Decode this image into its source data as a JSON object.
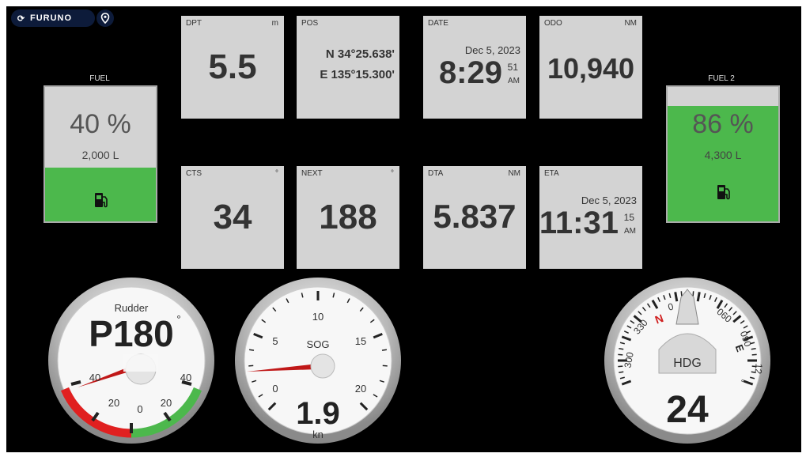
{
  "header": {
    "brand": "FURUNO",
    "brand_icon": "refresh-icon",
    "location_icon": "location-pin-icon"
  },
  "tiles": {
    "dpt": {
      "label": "DPT",
      "unit": "m",
      "value": "5.5"
    },
    "pos": {
      "label": "POS",
      "lat": "N 34°25.638'",
      "lon": "E 135°15.300'"
    },
    "date": {
      "label": "DATE",
      "date": "Dec 5, 2023",
      "time": "8:29",
      "seconds": "51",
      "ampm": "AM"
    },
    "odo": {
      "label": "ODO",
      "unit": "NM",
      "value": "10,940"
    },
    "cts": {
      "label": "CTS",
      "unit": "°",
      "value": "34"
    },
    "next": {
      "label": "NEXT",
      "unit": "°",
      "value": "188"
    },
    "dta": {
      "label": "DTA",
      "unit": "NM",
      "value": "5.837"
    },
    "eta": {
      "label": "ETA",
      "date": "Dec 5, 2023",
      "time": "11:31",
      "seconds": "15",
      "ampm": "AM"
    }
  },
  "fuel1": {
    "title": "FUEL",
    "percent": "40 %",
    "volume": "2,000 L",
    "level": 0.4,
    "icon": "fuel-pump-icon"
  },
  "fuel2": {
    "title": "FUEL 2",
    "percent": "86 %",
    "volume": "4,300 L",
    "level": 0.86,
    "icon": "fuel-pump-icon"
  },
  "rudder": {
    "label": "Rudder",
    "value": "P180",
    "unit": "°",
    "scale": [
      "40",
      "20",
      "0",
      "20",
      "40"
    ]
  },
  "sog": {
    "label": "SOG",
    "value": "1.9",
    "unit": "kn",
    "scale": [
      "0",
      "5",
      "10",
      "15",
      "20"
    ]
  },
  "hdg": {
    "label": "HDG",
    "value": "24",
    "unit": "°",
    "dial_north": "N",
    "dial_east": "E",
    "dial_marks": [
      "300",
      "330",
      "0",
      "060",
      "090",
      "12"
    ]
  },
  "colors": {
    "background": "#000000",
    "tile": "#d3d3d3",
    "fuel_green": "#4cb84c",
    "port_red": "#e02020",
    "stbd_green": "#4cb84c"
  }
}
